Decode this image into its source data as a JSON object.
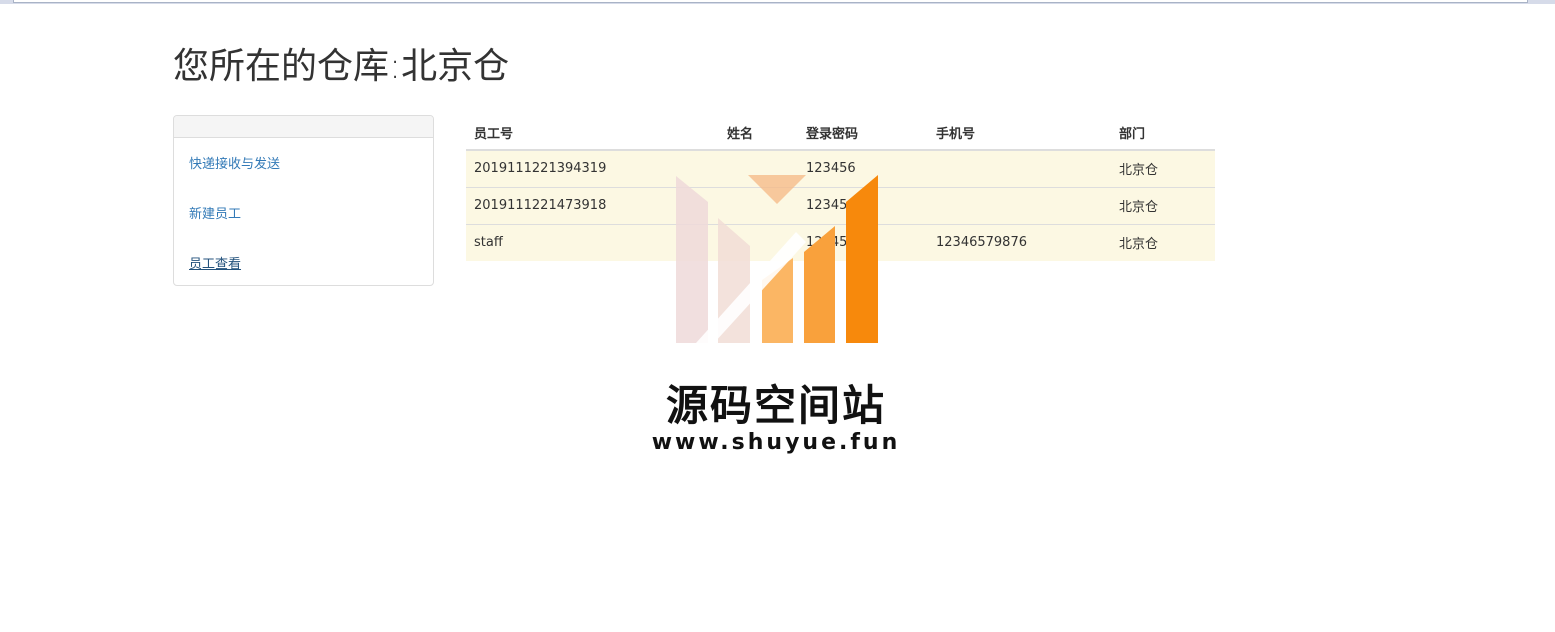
{
  "page": {
    "title": "您所在的仓库:北京仓"
  },
  "sidebar": {
    "items": [
      {
        "label": "快递接收与发送"
      },
      {
        "label": "新建员工"
      },
      {
        "label": "员工查看"
      }
    ]
  },
  "table": {
    "headers": [
      "员工号",
      "姓名",
      "登录密码",
      "手机号",
      "部门"
    ],
    "rows": [
      [
        "2019111221394319",
        "",
        "123456",
        "",
        "北京仓"
      ],
      [
        "2019111221473918",
        "",
        "123456",
        "",
        "北京仓"
      ],
      [
        "staff",
        "",
        "123456",
        "12346579876",
        "北京仓"
      ]
    ]
  },
  "watermark": {
    "name": "源码空间站",
    "url": "www.shuyue.fun"
  },
  "colors": {
    "link": "#337ab7",
    "row_warning": "#fcf8e3",
    "watermark_orange": "#f7890c"
  }
}
